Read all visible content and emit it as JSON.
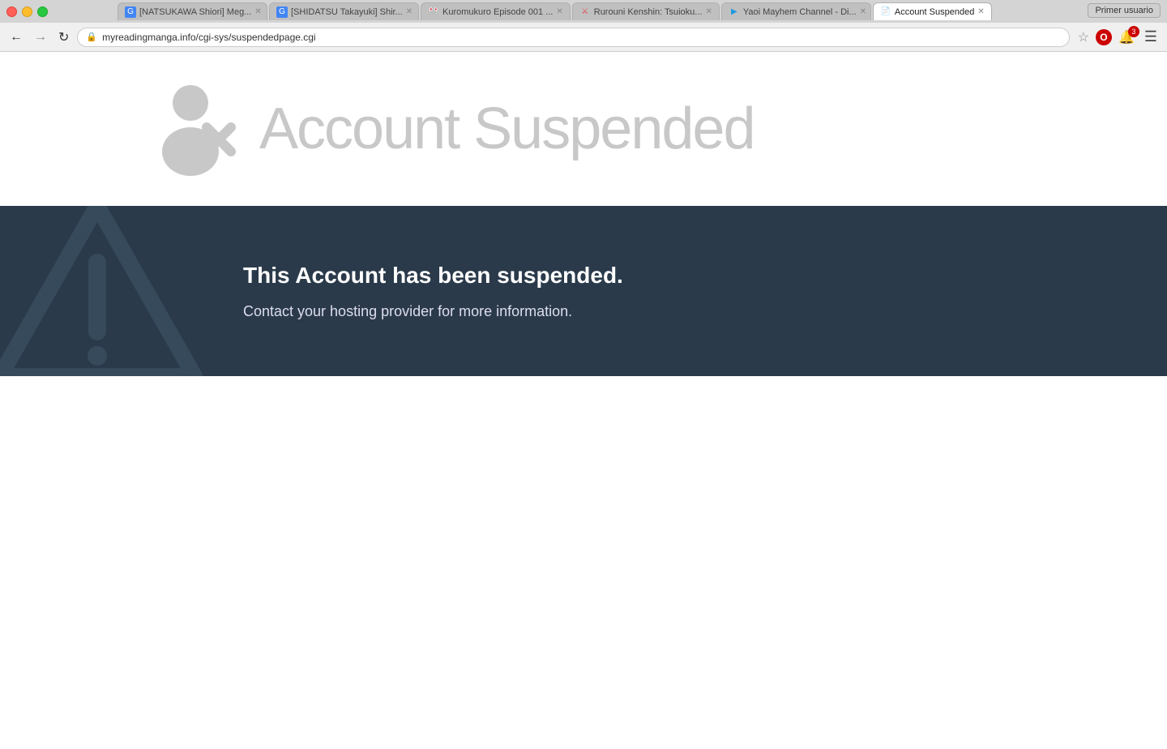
{
  "browser": {
    "primer_usuario": "Primer usuario",
    "tabs": [
      {
        "id": "tab1",
        "favicon": "G",
        "favicon_bg": "#4285f4",
        "label": "[NATSUKAWA Shiori] Meg...",
        "active": false,
        "closeable": true
      },
      {
        "id": "tab2",
        "favicon": "G",
        "favicon_bg": "#4285f4",
        "label": "[SHIDATSU Takayuki] Shir...",
        "active": false,
        "closeable": true
      },
      {
        "id": "tab3",
        "favicon": "🎌",
        "favicon_bg": "#ff6600",
        "label": "Kuromukuro Episode 001 ...",
        "active": false,
        "closeable": true
      },
      {
        "id": "tab4",
        "favicon": "🗡",
        "favicon_bg": "#e84040",
        "label": "Rurouni Kenshin: Tsuioku...",
        "active": false,
        "closeable": true
      },
      {
        "id": "tab5",
        "favicon": "▶",
        "favicon_bg": "#2299dd",
        "label": "Yaoi Mayhem Channel - Di...",
        "active": false,
        "closeable": true
      },
      {
        "id": "tab6",
        "favicon": "📄",
        "favicon_bg": "#fff",
        "label": "Account Suspended",
        "active": true,
        "closeable": true
      }
    ],
    "address_bar": {
      "url": "myreadingmanga.info/cgi-sys/suspendedpage.cgi",
      "lock_icon": "🔒"
    },
    "nav": {
      "back": "←",
      "forward": "→",
      "reload": "↻"
    },
    "opera_badge": "O",
    "notification_count": "3"
  },
  "page": {
    "title": "Account Suspended",
    "banner": {
      "heading": "This Account has been suspended.",
      "subtext": "Contact your hosting provider for more information."
    }
  }
}
